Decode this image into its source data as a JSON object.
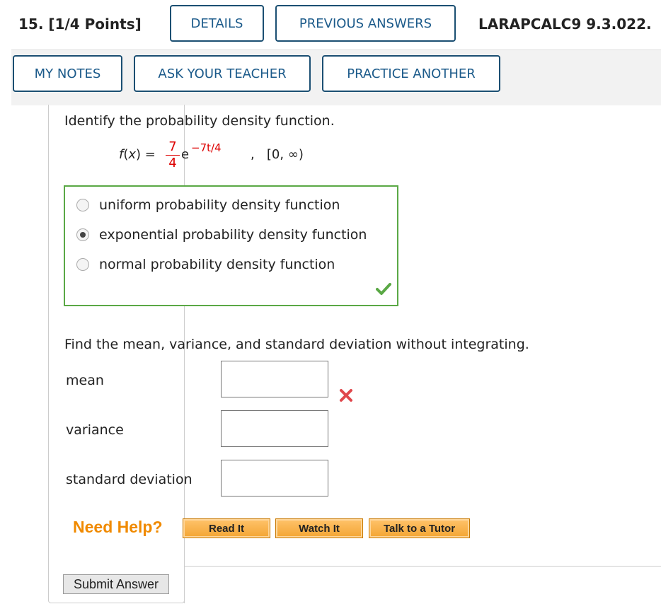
{
  "header": {
    "question_number": "15.",
    "points": "[1/4 Points]",
    "details_label": "DETAILS",
    "previous_answers_label": "PREVIOUS ANSWERS",
    "reference": "LARAPCALC9 9.3.022.",
    "my_notes_label": "MY NOTES",
    "ask_teacher_label": "ASK YOUR TEACHER",
    "practice_another_label": "PRACTICE ANOTHER"
  },
  "question": {
    "prompt": "Identify the probability density function.",
    "formula": {
      "lhs": "f(x) =",
      "numerator": "7",
      "denominator": "4",
      "base": "e",
      "exponent": "−7t/4",
      "separator": ",",
      "interval": "[0, ∞)"
    },
    "choices": [
      {
        "label": "uniform probability density function",
        "selected": false
      },
      {
        "label": "exponential probability density function",
        "selected": true
      },
      {
        "label": "normal probability density function",
        "selected": false
      }
    ],
    "choice_status": "correct",
    "part2_prompt": "Find the mean, variance, and standard deviation without integrating.",
    "fields": [
      {
        "label": "mean",
        "value": "",
        "status": "incorrect"
      },
      {
        "label": "variance",
        "value": ""
      },
      {
        "label": "standard deviation",
        "value": ""
      }
    ]
  },
  "help": {
    "title": "Need Help?",
    "read_it": "Read It",
    "watch_it": "Watch It",
    "talk_to_tutor": "Talk to a Tutor"
  },
  "submit_label": "Submit Answer",
  "colors": {
    "accent": "#1b5a8a",
    "correct": "#5aa845",
    "incorrect": "#e0474c",
    "help": "#f08a00"
  }
}
